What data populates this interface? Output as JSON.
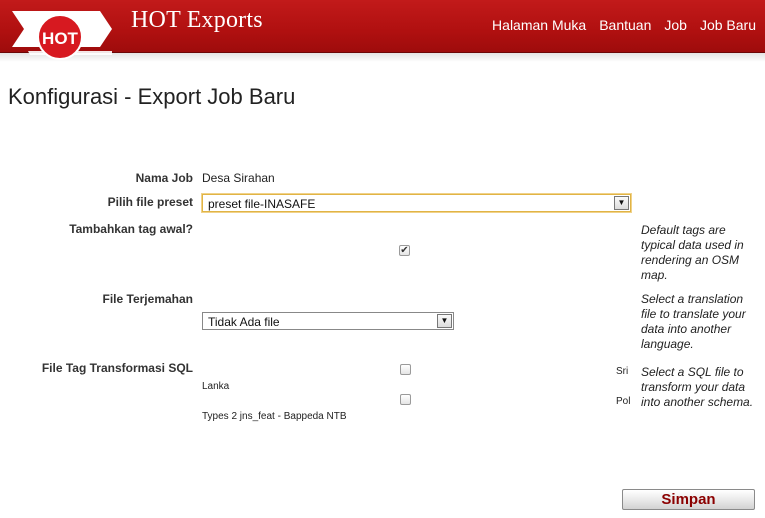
{
  "header": {
    "logo_text": "HOT",
    "app_title": "HOT Exports",
    "nav": [
      "Halaman Muka",
      "Bantuan",
      "Job",
      "Job Baru"
    ],
    "brand_color": "#b01010"
  },
  "page": {
    "title": "Konfigurasi - Export Job Baru"
  },
  "form": {
    "job_name": {
      "label": "Nama Job",
      "value": "Desa Sirahan"
    },
    "preset": {
      "label": "Pilih file preset",
      "selected": "preset file-INASAFE"
    },
    "default_tags": {
      "label": "Tambahkan tag awal?",
      "checked": true,
      "help": "Default tags are typical data used in rendering an OSM map."
    },
    "translation": {
      "label": "File Terjemahan",
      "selected": "Tidak Ada file",
      "help": "Select a translation file to translate your data into another language."
    },
    "sql_transform": {
      "label": "File Tag Transformasi SQL",
      "help": "Select a SQL file to transform your data into another schema.",
      "options": [
        {
          "prefix": "Sri",
          "name": "Lanka",
          "checked": false
        },
        {
          "prefix": "Pol",
          "name": "Types 2 jns_feat - Bappeda NTB",
          "checked": false
        }
      ]
    }
  },
  "submit_label": "Simpan"
}
